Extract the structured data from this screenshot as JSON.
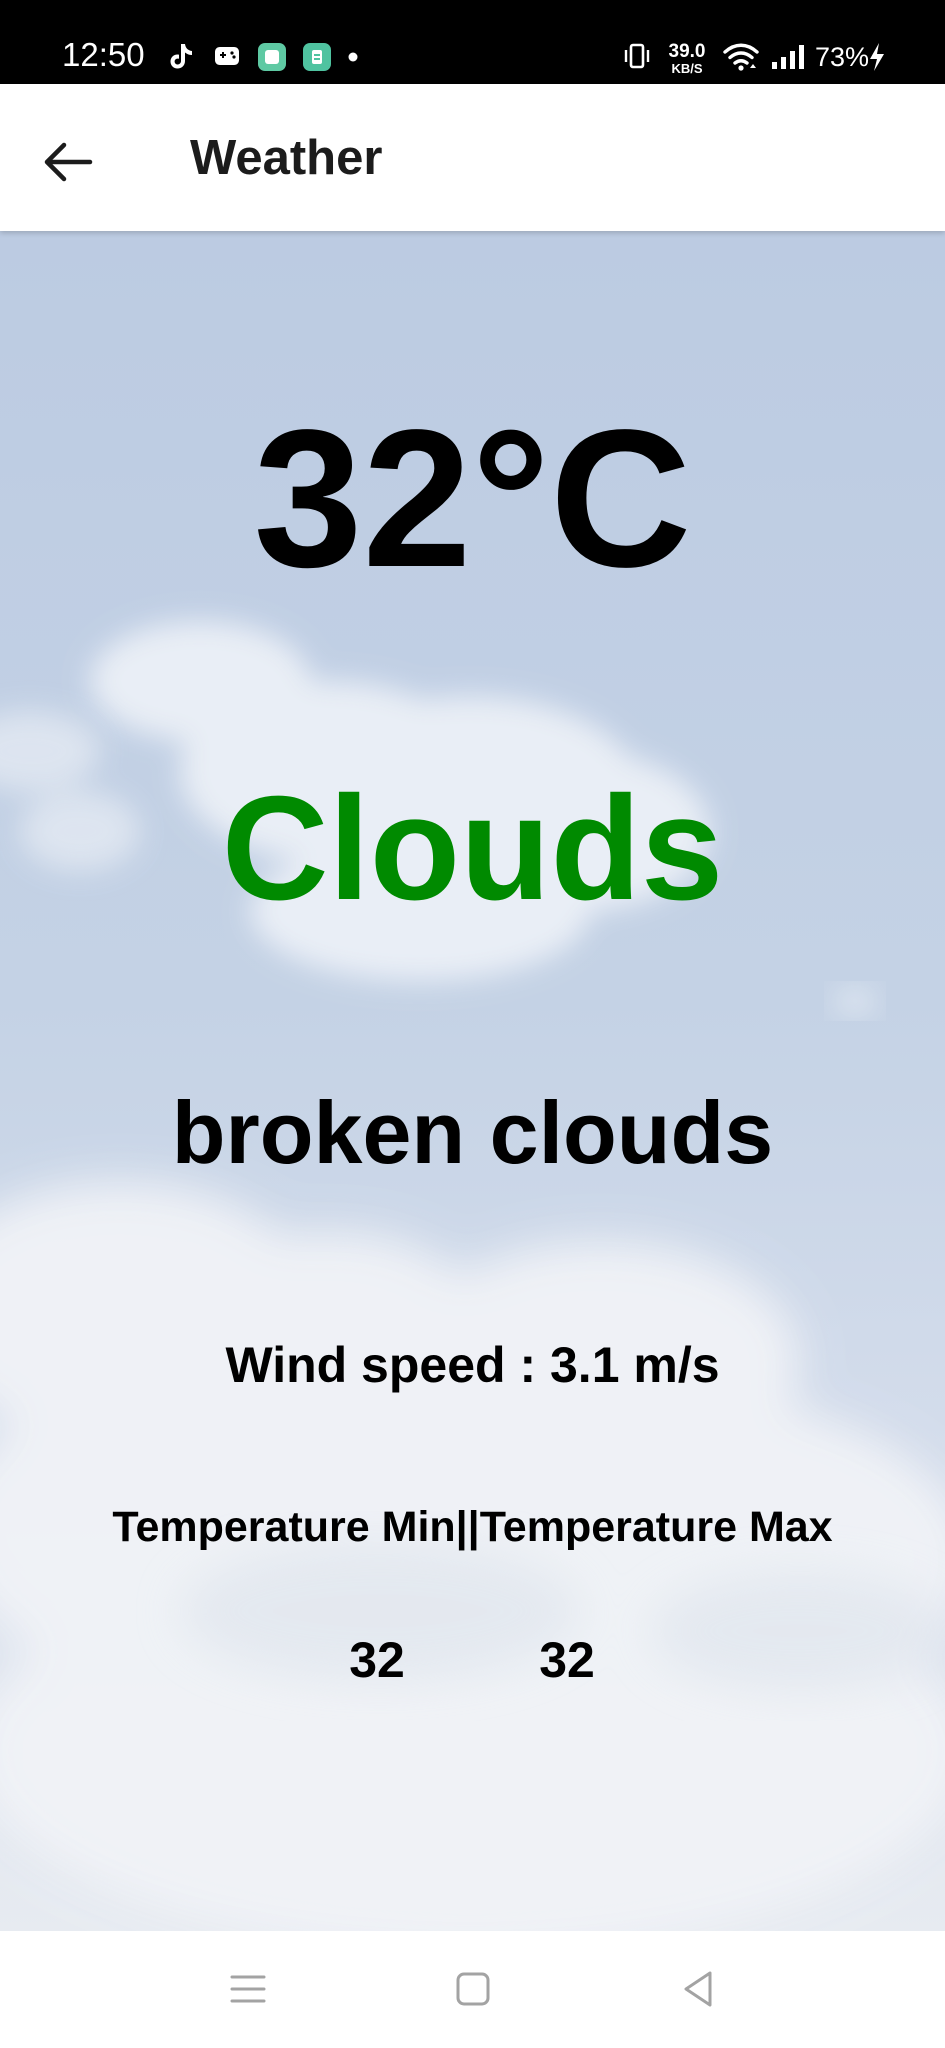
{
  "status_bar": {
    "time": "12:50",
    "net_speed": "39.0",
    "net_unit": "KB/S",
    "battery": "73%",
    "icons": [
      "tiktok-icon",
      "game-controller-icon",
      "app-icon",
      "app-icon",
      "dot-icon",
      "vibrate-icon",
      "wifi-icon",
      "signal-icon",
      "charging-icon"
    ]
  },
  "app_bar": {
    "title": "Weather",
    "back_icon": "arrow-left-icon"
  },
  "weather": {
    "temperature": "32°C",
    "main": "Clouds",
    "description": "broken clouds",
    "wind": "Wind speed : 3.1 m/s",
    "minmax_label": "Temperature Min||Temperature Max",
    "temp_min": "32",
    "temp_max": "32"
  },
  "nav_bar": {
    "icons": [
      "menu-icon",
      "home-icon",
      "back-icon"
    ]
  },
  "colors": {
    "status_bar_bg": "#000000",
    "app_bar_bg": "#ffffff",
    "sky": "#bccbe2",
    "accent_green": "#008a00",
    "text": "#000000"
  }
}
